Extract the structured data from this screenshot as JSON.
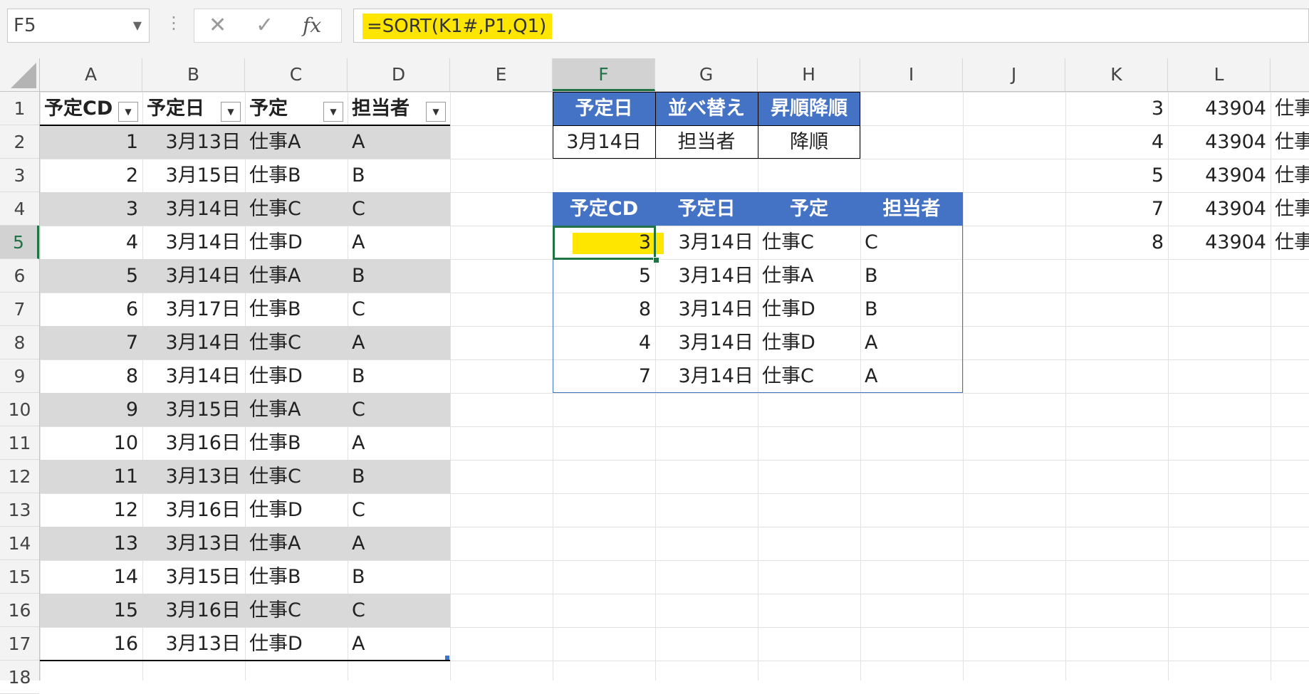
{
  "name_box": "F5",
  "formula_bar": {
    "cancel": "✕",
    "enter": "✓",
    "fx": "fx",
    "formula": "=SORT(K1#,P1,Q1)"
  },
  "columns": [
    "A",
    "B",
    "C",
    "D",
    "E",
    "F",
    "G",
    "H",
    "I",
    "J",
    "K",
    "L"
  ],
  "rows": [
    "1",
    "2",
    "3",
    "4",
    "5",
    "6",
    "7",
    "8",
    "9",
    "10",
    "11",
    "12",
    "13",
    "14",
    "15",
    "16",
    "17",
    "18"
  ],
  "table1": {
    "headers": [
      "予定CD",
      "予定日",
      "予定",
      "担当者"
    ],
    "rows": [
      [
        "1",
        "3月13日",
        "仕事A",
        "A"
      ],
      [
        "2",
        "3月15日",
        "仕事B",
        "B"
      ],
      [
        "3",
        "3月14日",
        "仕事C",
        "C"
      ],
      [
        "4",
        "3月14日",
        "仕事D",
        "A"
      ],
      [
        "5",
        "3月14日",
        "仕事A",
        "B"
      ],
      [
        "6",
        "3月17日",
        "仕事B",
        "C"
      ],
      [
        "7",
        "3月14日",
        "仕事C",
        "A"
      ],
      [
        "8",
        "3月14日",
        "仕事D",
        "B"
      ],
      [
        "9",
        "3月15日",
        "仕事A",
        "C"
      ],
      [
        "10",
        "3月16日",
        "仕事B",
        "A"
      ],
      [
        "11",
        "3月13日",
        "仕事C",
        "B"
      ],
      [
        "12",
        "3月16日",
        "仕事D",
        "C"
      ],
      [
        "13",
        "3月13日",
        "仕事A",
        "A"
      ],
      [
        "14",
        "3月15日",
        "仕事B",
        "B"
      ],
      [
        "15",
        "3月16日",
        "仕事C",
        "C"
      ],
      [
        "16",
        "3月13日",
        "仕事D",
        "A"
      ]
    ]
  },
  "criteria": {
    "headers": [
      "予定日",
      "並べ替え",
      "昇順降順"
    ],
    "values": [
      "3月14日",
      "担当者",
      "降順"
    ]
  },
  "result": {
    "headers": [
      "予定CD",
      "予定日",
      "予定",
      "担当者"
    ],
    "rows": [
      [
        "3",
        "3月14日",
        "仕事C",
        "C"
      ],
      [
        "5",
        "3月14日",
        "仕事A",
        "B"
      ],
      [
        "8",
        "3月14日",
        "仕事D",
        "B"
      ],
      [
        "4",
        "3月14日",
        "仕事D",
        "A"
      ],
      [
        "7",
        "3月14日",
        "仕事C",
        "A"
      ]
    ]
  },
  "spill": {
    "rows": [
      [
        "3",
        "43904",
        "仕事"
      ],
      [
        "4",
        "43904",
        "仕事"
      ],
      [
        "5",
        "43904",
        "仕事"
      ],
      [
        "7",
        "43904",
        "仕事"
      ],
      [
        "8",
        "43904",
        "仕事"
      ]
    ]
  }
}
